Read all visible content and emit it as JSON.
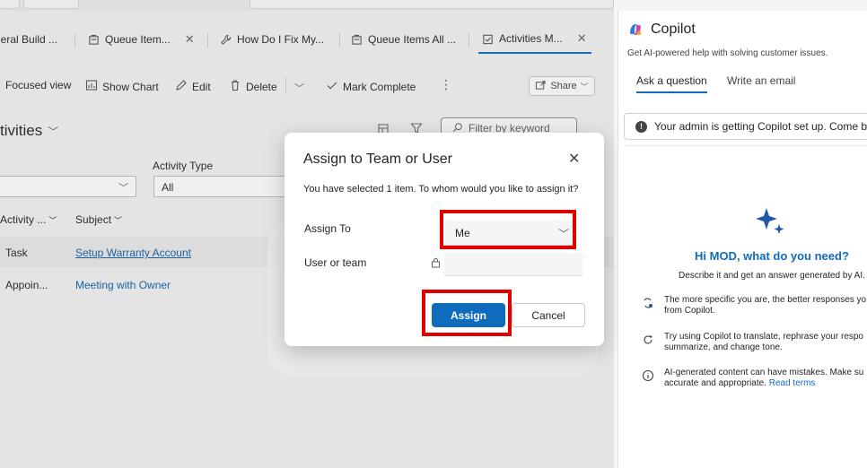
{
  "tabs": [
    {
      "label": "neral Build ...",
      "icon": "",
      "closable": false
    },
    {
      "label": "Queue Item...",
      "icon": "queue-icon",
      "closable": true
    },
    {
      "label": "How Do I Fix My...",
      "icon": "wrench-icon",
      "closable": false
    },
    {
      "label": "Queue Items All ...",
      "icon": "queue-icon",
      "closable": false
    },
    {
      "label": "Activities M...",
      "icon": "activity-icon",
      "closable": true,
      "active": true
    }
  ],
  "commands": {
    "focused_view": "Focused view",
    "show_chart": "Show Chart",
    "edit": "Edit",
    "delete": "Delete",
    "mark_complete": "Mark Complete",
    "share": "Share"
  },
  "view": {
    "title": "tivities",
    "filter_placeholder": "Filter by keyword",
    "activity_type_label": "Activity Type",
    "activity_type_value": "All"
  },
  "grid": {
    "columns": [
      "Activity ...",
      "Subject"
    ],
    "rows": [
      {
        "type": "Task",
        "subject": "Setup Warranty Account"
      },
      {
        "type": "Appoin...",
        "subject": "Meeting with Owner"
      }
    ]
  },
  "dialog": {
    "title": "Assign to Team or User",
    "description": "You have selected 1 item. To whom would you like to assign it?",
    "assign_to_label": "Assign To",
    "assign_to_value": "Me",
    "user_team_label": "User or team",
    "assign_button": "Assign",
    "cancel_button": "Cancel"
  },
  "copilot": {
    "title": "Copilot",
    "subtitle": "Get AI-powered help with solving customer issues.",
    "tab_ask": "Ask a question",
    "tab_email": "Write an email",
    "notice": "Your admin is getting Copilot set up. Come b",
    "greeting": "Hi MOD, what do you need?",
    "describe": "Describe it and get an answer generated by AI.",
    "tips": [
      {
        "line1": "The more specific you are, the better responses yo",
        "line2": "from Copilot."
      },
      {
        "line1": "Try using Copilot to translate, rephrase your respo",
        "line2": "summarize, and change tone."
      },
      {
        "line1": "AI-generated content can have mistakes. Make su",
        "line2": "accurate and appropriate.",
        "link": "Read terms"
      }
    ]
  },
  "colors": {
    "accent": "#0f6cbd",
    "highlight": "#e00000"
  }
}
